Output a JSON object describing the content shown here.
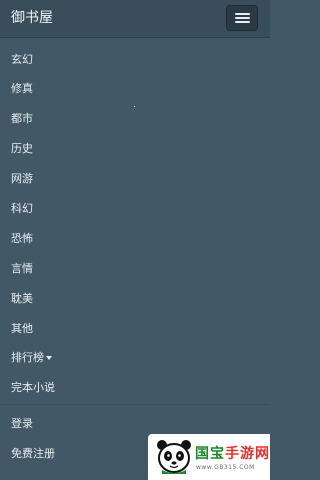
{
  "navbar": {
    "brand": "御书屋",
    "menu_toggle_icon": "hamburger-icon"
  },
  "menu": {
    "items": [
      {
        "label": "玄幻"
      },
      {
        "label": "修真"
      },
      {
        "label": "都市"
      },
      {
        "label": "历史"
      },
      {
        "label": "网游"
      },
      {
        "label": "科幻"
      },
      {
        "label": "恐怖"
      },
      {
        "label": "言情"
      },
      {
        "label": "耽美"
      },
      {
        "label": "其他"
      },
      {
        "label": "排行榜",
        "has_caret": true
      },
      {
        "label": "完本小说"
      }
    ],
    "account_items": [
      {
        "label": "登录"
      },
      {
        "label": "免费注册"
      }
    ]
  },
  "watermark": {
    "title_part1": "国宝",
    "title_part2": "手游网",
    "url": "www.GB315.COM"
  },
  "colors": {
    "background": "#435866",
    "navbar": "#3a4d5a",
    "text": "#e6edf1",
    "watermark_green": "#1b8a2a",
    "watermark_red": "#e5322d"
  }
}
